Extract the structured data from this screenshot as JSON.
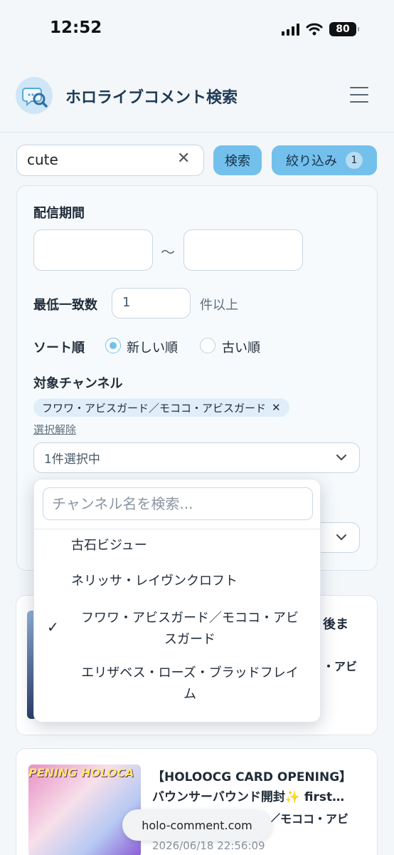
{
  "status_bar": {
    "time": "12:52",
    "battery": "80"
  },
  "header": {
    "title": "ホロライブコメント検索"
  },
  "search": {
    "value": "cute",
    "clear": "✕",
    "search_label": "検索",
    "filter_label": "絞り込み",
    "filter_count": "1"
  },
  "filters": {
    "period_label": "配信期間",
    "period_sep": "〜",
    "min_match_label": "最低一致数",
    "min_match_value": "1",
    "min_match_suffix": "件以上",
    "sort_label": "ソート順",
    "sort_options": [
      "新しい順",
      "古い順"
    ],
    "sort_selected": "新しい順",
    "channel_label": "対象チャンネル",
    "selected_channel": "フワワ・アビスガード／モココ・アビスガード",
    "chip_remove": "✕",
    "clear_selection": "選択解除",
    "channel_select_value": "1件選択中"
  },
  "dropdown": {
    "search_placeholder": "チャンネル名を検索...",
    "items": [
      {
        "line1": "古石ビジュー",
        "line2": ""
      },
      {
        "line1": "ネリッサ・レイヴンクロフト",
        "line2": ""
      },
      {
        "line1": "フワワ・アビスガード／モココ・アビ",
        "line2": "スガード"
      },
      {
        "line1": "エリザベス・ローズ・ブラッドフレイ",
        "line2": "ム"
      }
    ],
    "checked": "✓"
  },
  "results": [
    {
      "title_fragment": "後ま",
      "channel_fragment": "・アビ"
    },
    {
      "title_line1": "【HOLOOCG CARD OPENING】",
      "title_line2": "バウンサーバウンド開封✨ first…",
      "channel_fragment": "ガード／モココ・アビ",
      "date": "2026/06/18 22:56:09",
      "thumb_text": "PENING HOLOCA"
    }
  ],
  "browser": {
    "domain": "holo-comment.com"
  },
  "colors": {
    "accent": "#74c0ec",
    "background": "#f3f7fa",
    "text": "#1f2b38"
  },
  "icons": {
    "logo": "search-chat-logo-icon",
    "menu": "hamburger-menu-icon",
    "chevron": "chevron-down-icon",
    "check": "checkmark-icon"
  }
}
